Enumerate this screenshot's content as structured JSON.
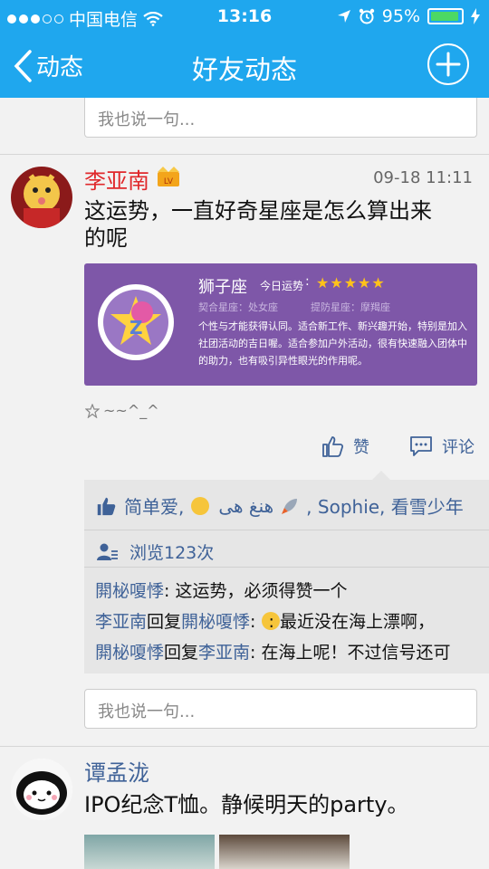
{
  "status": {
    "carrier": "中国电信",
    "time": "13:16",
    "battery": "95%"
  },
  "nav": {
    "back_label": "动态",
    "title": "好友动态"
  },
  "top_comment": {
    "placeholder": "我也说一句..."
  },
  "post1": {
    "author": "李亚南",
    "time": "09-18 11:11",
    "text_line1": "这运势，一直好奇星座是怎么算出来",
    "text_line2": "的呢",
    "card": {
      "sign": "狮子座",
      "today_label": "今日运势",
      "stars": "★★★★★",
      "match": "契合星座：处女座",
      "guard": "提防星座：摩羯座",
      "description": "个性与才能获得认同。适合新工作、新兴趣开始，特别是加入社团活动的吉日喔。适合参加户外活动，很有快速融入团体中的助力，也有吸引异性眼光的作用呢。"
    },
    "tag": "~~^_^",
    "like_label": "赞",
    "comment_label": "评论",
    "likes_prefix": "简单爱,",
    "likes_rest": "هنغ هى",
    "likes_tail": ", Sophie, 看雪少年",
    "views": "浏览123次",
    "replies": [
      {
        "user": "閞柲嗄悸",
        "text": ": 这运势，必须得赞一个"
      },
      {
        "user": "李亚南",
        "mid": "回复",
        "user2": "閞柲嗄悸",
        "text": ": 最近没在海上漂啊，"
      },
      {
        "user": "閞柲嗄悸",
        "mid": "回复",
        "user2": "李亚南",
        "text": ": 在海上呢！不过信号还可"
      }
    ],
    "comment_placeholder": "我也说一句..."
  },
  "post2": {
    "author": "谭孟泷",
    "text": "IPO纪念T恤。静候明天的party。"
  },
  "colors": {
    "accent": "#1fa7ee",
    "name_red": "#e0282b",
    "link_blue": "#3f6298",
    "card_purple": "#7e57a8"
  }
}
